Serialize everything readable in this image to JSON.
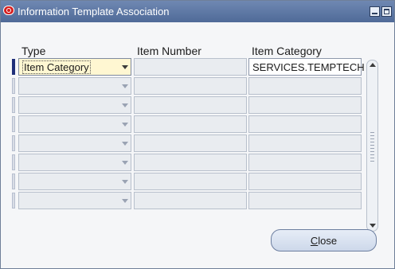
{
  "window": {
    "title": "Information Template Association"
  },
  "table": {
    "columns": [
      {
        "label": "Type"
      },
      {
        "label": "Item Number"
      },
      {
        "label": "Item Category"
      }
    ],
    "rows": [
      {
        "type": "Item Category",
        "item_number": "",
        "item_category": "SERVICES.TEMPTECH",
        "active": true
      },
      {
        "type": "",
        "item_number": "",
        "item_category": ""
      },
      {
        "type": "",
        "item_number": "",
        "item_category": ""
      },
      {
        "type": "",
        "item_number": "",
        "item_category": ""
      },
      {
        "type": "",
        "item_number": "",
        "item_category": ""
      },
      {
        "type": "",
        "item_number": "",
        "item_category": ""
      },
      {
        "type": "",
        "item_number": "",
        "item_category": ""
      },
      {
        "type": "",
        "item_number": "",
        "item_category": ""
      }
    ]
  },
  "buttons": {
    "close_first": "C",
    "close_rest": "lose"
  }
}
